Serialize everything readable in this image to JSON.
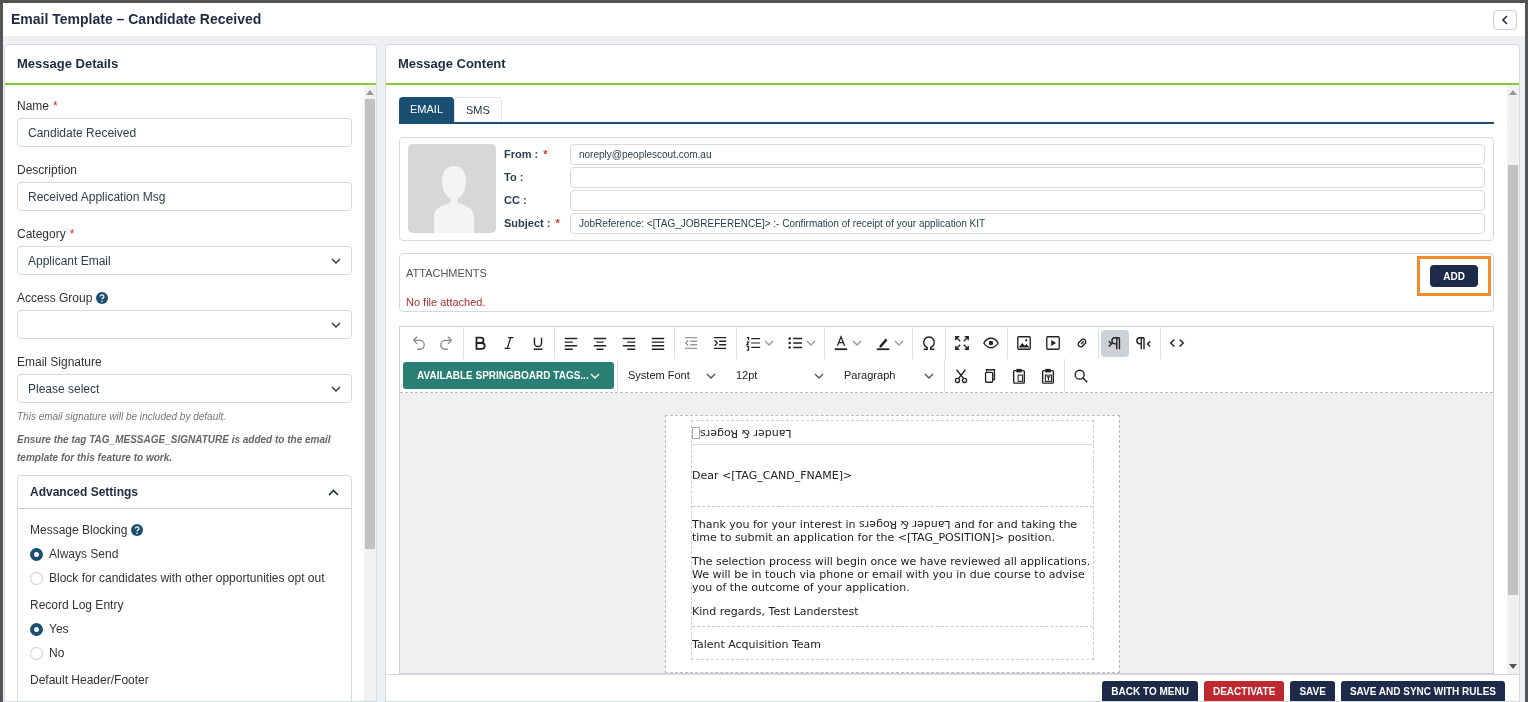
{
  "window": {
    "title": "Email Template – Candidate Received"
  },
  "details": {
    "title": "Message Details",
    "fields": [
      {
        "kind": "text",
        "label": "Name",
        "marker": "*",
        "value": "Candidate Received"
      },
      {
        "kind": "text",
        "label": "Description",
        "value": "Received Application Msg"
      },
      {
        "kind": "select",
        "label": "Category",
        "marker": "*",
        "value": "Applicant Email"
      },
      {
        "kind": "select",
        "label": "Access Group",
        "help": true
      },
      {
        "kind": "select",
        "label": "Email Signature",
        "value": "Please select"
      }
    ],
    "hint": "This email signature will be included by default.",
    "note": "Ensure the tag TAG_MESSAGE_SIGNATURE is added to the email template for this feature to work.",
    "advanced": {
      "title": "Advanced Settings",
      "expanded": true,
      "groups": [
        {
          "label": "Message Blocking",
          "help": true,
          "options": [
            {
              "label": "Always Send",
              "selected": true
            },
            {
              "label": "Block for candidates with other opportunities opt out",
              "selected": false
            }
          ]
        },
        {
          "label": "Record Log Entry",
          "options": [
            {
              "label": "Yes",
              "selected": true
            },
            {
              "label": "No",
              "selected": false
            }
          ]
        },
        {
          "label": "Default Header/Footer"
        }
      ]
    }
  },
  "content": {
    "title": "Message Content",
    "tabs": [
      {
        "label": "EMAIL",
        "selected": true
      },
      {
        "label": "SMS",
        "selected": false
      }
    ],
    "fields": [
      {
        "label": "From :",
        "marker": "*",
        "value": "noreply@peoplescout.com.au"
      },
      {
        "label": "To :"
      },
      {
        "label": "CC :"
      },
      {
        "label": "Subject :",
        "marker": "*",
        "value": "JobReference: <[TAG_JOBREFERENCE]> :- Confirmation of receipt of your application KIT"
      }
    ],
    "attachments": {
      "title": "ATTACHMENTS",
      "empty": "No file attached.",
      "button": "ADD",
      "highlighted": true
    },
    "toolbar": [
      [
        {
          "kind": "undo",
          "on": false
        },
        {
          "kind": "redo",
          "on": false
        }
      ],
      [
        {
          "kind": "bold",
          "on": false
        },
        {
          "kind": "italic",
          "on": false
        },
        {
          "kind": "underline",
          "on": false
        }
      ],
      [
        {
          "kind": "align-left",
          "on": false
        },
        {
          "kind": "align-center",
          "on": false
        },
        {
          "kind": "align-right",
          "on": false
        },
        {
          "kind": "justify",
          "on": false
        }
      ],
      [
        {
          "kind": "outdent",
          "on": false
        },
        {
          "kind": "indent",
          "on": false
        }
      ],
      [
        {
          "kind": "numbered-list",
          "on": false
        },
        {
          "kind": "bullet-list",
          "on": false
        }
      ],
      [
        {
          "kind": "text-color",
          "on": false
        },
        {
          "kind": "highlight",
          "on": false
        }
      ],
      [
        {
          "kind": "omega",
          "on": false
        }
      ],
      [
        {
          "kind": "fullscreen",
          "on": false
        },
        {
          "kind": "preview",
          "on": false
        }
      ],
      [
        {
          "kind": "image",
          "on": false
        },
        {
          "kind": "media",
          "on": false
        },
        {
          "kind": "link",
          "on": false
        }
      ],
      [
        {
          "kind": "ltr",
          "on": true
        },
        {
          "kind": "rtl",
          "on": false
        }
      ],
      [
        {
          "kind": "code",
          "on": false
        }
      ]
    ],
    "tags_button": "AVAILABLE SPRINGBOARD TAGS...",
    "selects": [
      "System Font",
      "12pt",
      "Paragraph"
    ],
    "toolbar2": [
      [
        {
          "kind": "cut",
          "on": false
        },
        {
          "kind": "copy",
          "on": false
        },
        {
          "kind": "paste",
          "on": false
        },
        {
          "kind": "paste-text",
          "on": false
        }
      ],
      [
        {
          "kind": "search",
          "on": false
        }
      ]
    ],
    "email": {
      "logo_alt": "Lander & Rogers",
      "sections": [
        {
          "paragraphs": [
            [
              {
                "text": "Dear <[TAG_CAND_FNAME]>"
              }
            ]
          ]
        },
        {
          "paragraphs": [
            [
              {
                "text": "Thank you for your interest in "
              },
              {
                "text": "Lander & Rogers",
                "flipped": true
              },
              {
                "text": " and for and taking the time to submit an application for the <[TAG_POSITION]> position."
              }
            ],
            [
              {
                "text": "The selection process will begin once we have reviewed all applications. We will be in touch via phone or email with you in due course to advise you of the outcome of your application."
              }
            ],
            [
              {
                "text": "Kind regards, Test Landerstest"
              }
            ]
          ]
        },
        {
          "paragraphs": [
            [
              {
                "text": "Talent Acquisition Team"
              }
            ]
          ]
        }
      ]
    }
  },
  "footer": {
    "buttons": [
      {
        "label": "BACK TO MENU",
        "kind": "primary"
      },
      {
        "label": "DEACTIVATE",
        "kind": "danger"
      },
      {
        "label": "SAVE",
        "kind": "primary"
      },
      {
        "label": "SAVE AND SYNC WITH RULES",
        "kind": "primary"
      }
    ]
  }
}
